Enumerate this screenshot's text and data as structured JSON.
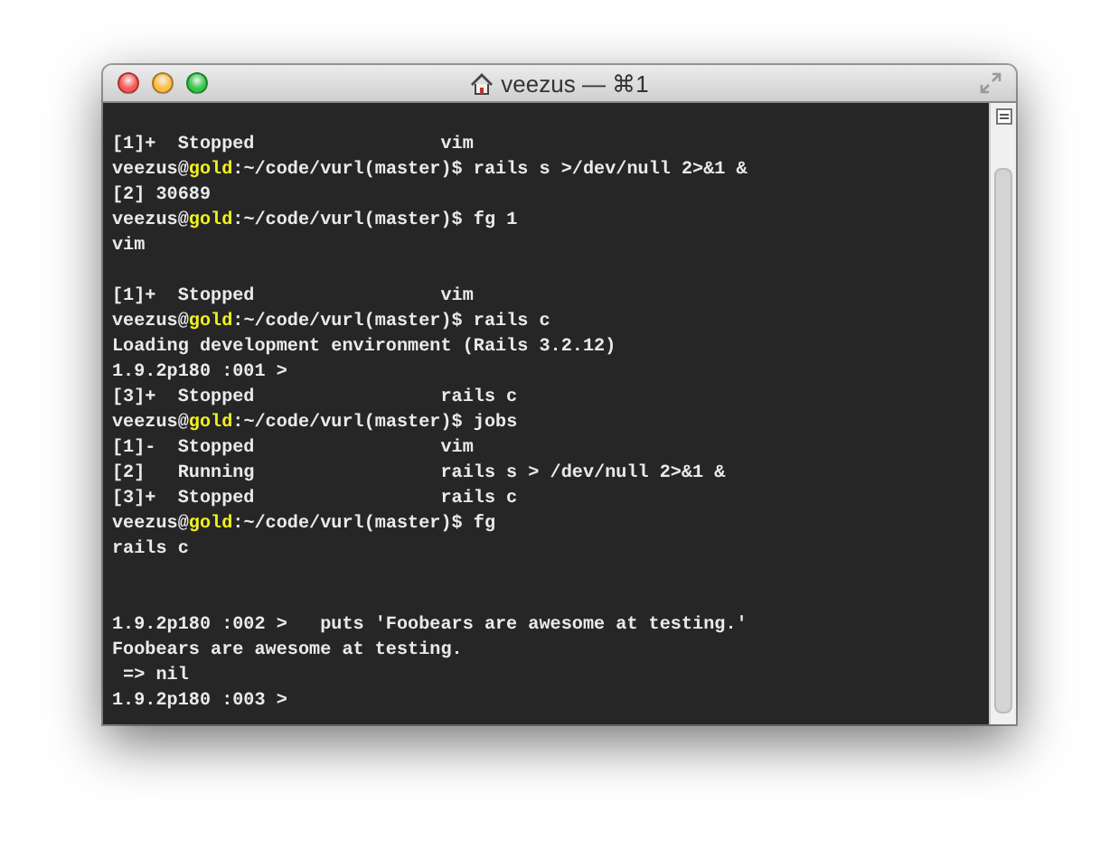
{
  "window": {
    "title": "veezus — ⌘1"
  },
  "lines": [
    {
      "kind": "blank"
    },
    {
      "kind": "output",
      "text": "[1]+  Stopped                 vim"
    },
    {
      "kind": "prompt",
      "user": "veezus@",
      "host": "gold",
      "path": ":~/code/vurl(master)$ ",
      "command": "rails s >/dev/null 2>&1 &"
    },
    {
      "kind": "output",
      "text": "[2] 30689"
    },
    {
      "kind": "prompt",
      "user": "veezus@",
      "host": "gold",
      "path": ":~/code/vurl(master)$ ",
      "command": "fg 1"
    },
    {
      "kind": "output",
      "text": "vim"
    },
    {
      "kind": "blank"
    },
    {
      "kind": "output",
      "text": "[1]+  Stopped                 vim"
    },
    {
      "kind": "prompt",
      "user": "veezus@",
      "host": "gold",
      "path": ":~/code/vurl(master)$ ",
      "command": "rails c"
    },
    {
      "kind": "output",
      "text": "Loading development environment (Rails 3.2.12)"
    },
    {
      "kind": "output",
      "text": "1.9.2p180 :001 >"
    },
    {
      "kind": "output",
      "text": "[3]+  Stopped                 rails c"
    },
    {
      "kind": "prompt",
      "user": "veezus@",
      "host": "gold",
      "path": ":~/code/vurl(master)$ ",
      "command": "jobs"
    },
    {
      "kind": "output",
      "text": "[1]-  Stopped                 vim"
    },
    {
      "kind": "output",
      "text": "[2]   Running                 rails s > /dev/null 2>&1 &"
    },
    {
      "kind": "output",
      "text": "[3]+  Stopped                 rails c"
    },
    {
      "kind": "prompt",
      "user": "veezus@",
      "host": "gold",
      "path": ":~/code/vurl(master)$ ",
      "command": "fg"
    },
    {
      "kind": "output",
      "text": "rails c"
    },
    {
      "kind": "blank"
    },
    {
      "kind": "blank"
    },
    {
      "kind": "output",
      "text": "1.9.2p180 :002 >   puts 'Foobears are awesome at testing.'"
    },
    {
      "kind": "output",
      "text": "Foobears are awesome at testing."
    },
    {
      "kind": "output",
      "text": " => nil"
    },
    {
      "kind": "output",
      "text": "1.9.2p180 :003 >"
    }
  ]
}
